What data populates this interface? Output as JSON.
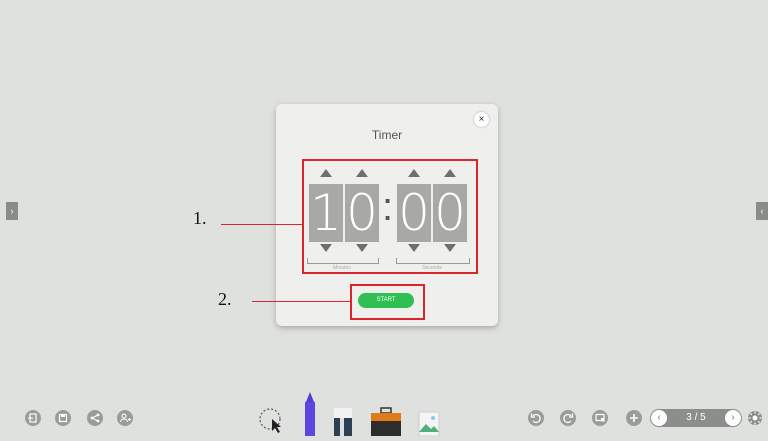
{
  "dialog": {
    "title": "Timer",
    "close_label": "×",
    "minutes": [
      "1",
      "0"
    ],
    "seconds": [
      "0",
      "0"
    ],
    "colon": ":",
    "minutes_label": "Minutes",
    "seconds_label": "Seconds",
    "start_label": "START"
  },
  "annotations": {
    "callout_1": "1.",
    "callout_2": "2."
  },
  "side_tabs": {
    "left_glyph": "›",
    "right_glyph": "‹"
  },
  "toolbar": {
    "page_indicator": "3 / 5",
    "prev_glyph": "‹",
    "next_glyph": "›"
  },
  "colors": {
    "accent_green": "#2fbf52",
    "callout_red": "#d9262b",
    "digit_bg": "#a8a9a7"
  }
}
